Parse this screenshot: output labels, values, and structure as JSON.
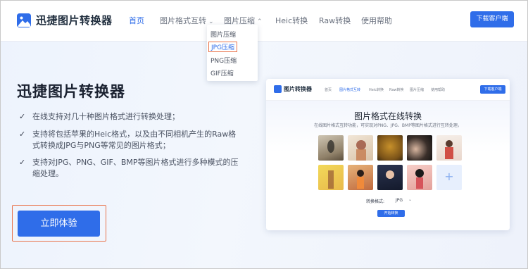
{
  "brand": {
    "name": "迅捷图片转换器"
  },
  "nav": {
    "items": [
      {
        "label": "首页",
        "active": true
      },
      {
        "label": "图片格式互转",
        "has_dropdown": true
      },
      {
        "label": "图片压缩",
        "has_dropdown": true,
        "open": true
      },
      {
        "label": "Heic转换"
      },
      {
        "label": "Raw转换"
      },
      {
        "label": "使用帮助"
      }
    ],
    "download_label": "下载客户端"
  },
  "dropdown": {
    "items": [
      {
        "label": "图片压缩"
      },
      {
        "label": "JPG压缩",
        "highlighted": true
      },
      {
        "label": "PNG压缩"
      },
      {
        "label": "GIF压缩"
      }
    ]
  },
  "hero": {
    "title": "迅捷图片转换器",
    "features": [
      "在线支持对几十种图片格式进行转换处理；",
      "支持将包括苹果的Heic格式，以及由不同相机产生的Raw格式转换成JPG与PNG等常见的图片格式；",
      "支持对JPG、PNG、GIF、BMP等图片格式进行多种模式的压缩处理。"
    ],
    "cta_label": "立即体验"
  },
  "preview": {
    "brand": "图片转换器",
    "nav": [
      "首页",
      "图片格式互转",
      "Heic转换",
      "Raw转换",
      "图片压缩",
      "使用帮助"
    ],
    "download_label": "下载客户端",
    "title": "图片格式在线转换",
    "subtitle": "在线图片格式互转功能，可实现对PNG、JPG、BMP等图片格式进行互转处理。",
    "format_label": "转换格式:",
    "format_value": "JPG",
    "convert_label": "开始转换",
    "thumbnail_count": 10
  },
  "colors": {
    "accent": "#2f6de9",
    "highlight_outline": "#e9744c"
  }
}
